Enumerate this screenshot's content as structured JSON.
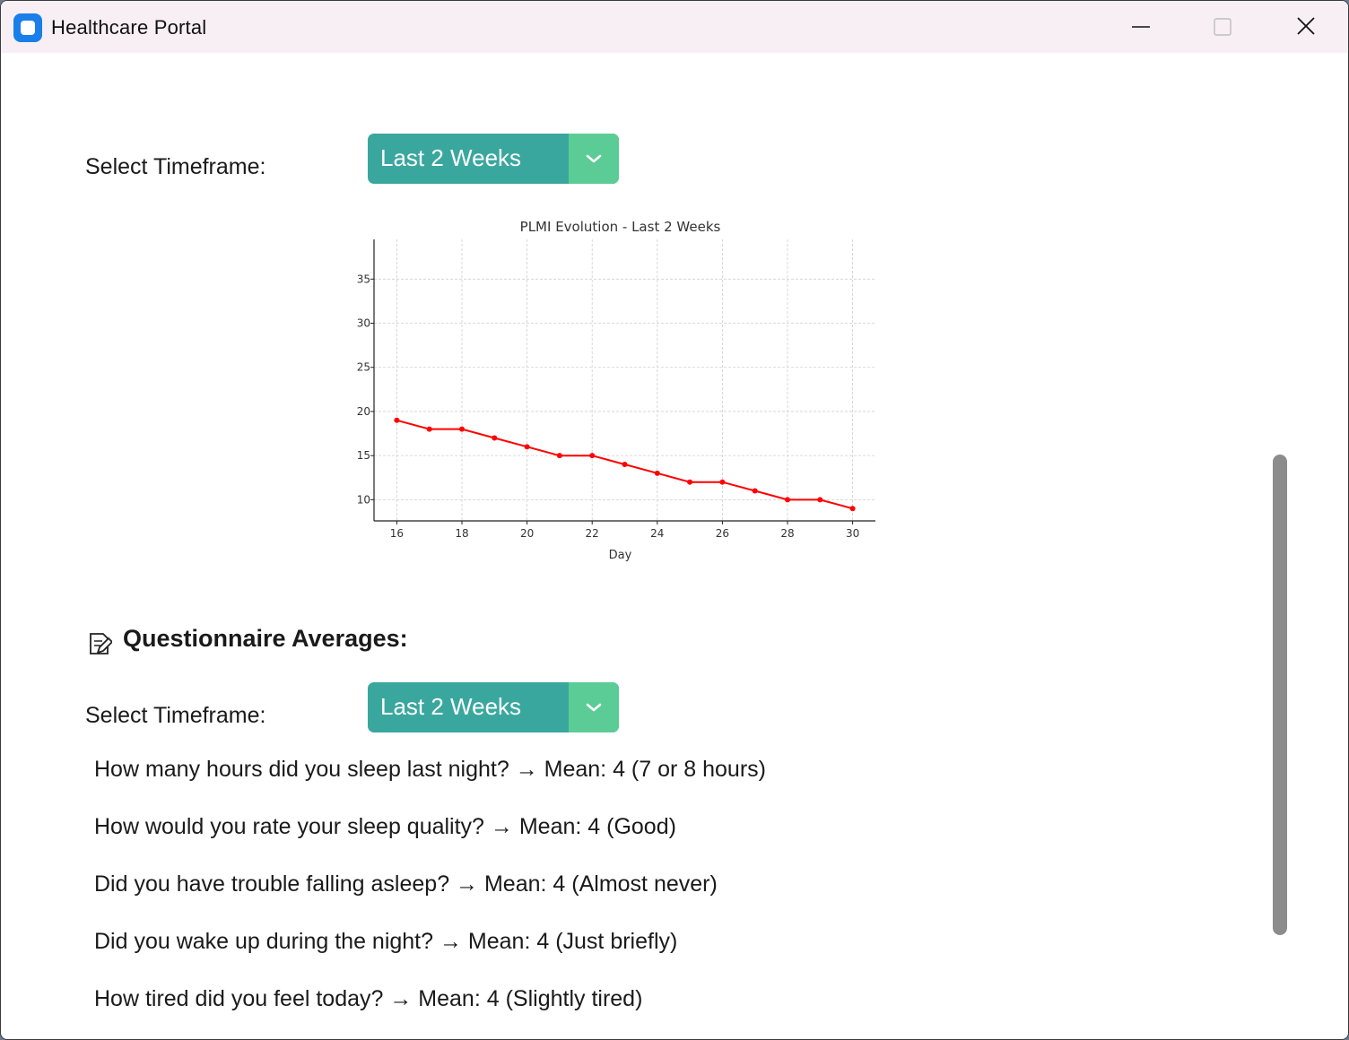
{
  "window": {
    "title": "Healthcare Portal",
    "controls": {
      "minimize": "minimize-icon",
      "maximize": "maximize-icon",
      "close": "close-icon"
    }
  },
  "plmi_section": {
    "timeframe_label": "Select Timeframe:",
    "timeframe_value": "Last 2 Weeks"
  },
  "chart_data": {
    "type": "line",
    "title": "PLMI Evolution - Last 2 Weeks",
    "xlabel": "Day",
    "ylabel": "",
    "x": [
      16,
      17,
      18,
      19,
      20,
      21,
      22,
      23,
      24,
      25,
      26,
      27,
      28,
      29,
      30
    ],
    "series": [
      {
        "values": [
          19,
          18,
          18,
          17,
          16,
          15,
          15,
          14,
          13,
          12,
          12,
          11,
          10,
          10,
          9
        ],
        "color": "#ff0000"
      }
    ],
    "xticks": [
      16,
      18,
      20,
      22,
      24,
      26,
      28,
      30
    ],
    "yticks": [
      10,
      15,
      20,
      25,
      30,
      35
    ],
    "xlim": [
      15.3,
      30.7
    ],
    "ylim": [
      7.6,
      39.5
    ],
    "grid": true
  },
  "questionnaire": {
    "icon": "memo-icon",
    "title": "Questionnaire Averages:",
    "timeframe_label": "Select Timeframe:",
    "timeframe_value": "Last 2 Weeks",
    "items": [
      "How many hours did you sleep last night? → Mean: 4 (7 or 8 hours)",
      "How would you rate your sleep quality? → Mean: 4 (Good)",
      "Did you have trouble falling asleep? → Mean: 4 (Almost never)",
      "Did you wake up during the night? → Mean: 4 (Just briefly)",
      "How tired did you feel today? → Mean: 4 (Slightly tired)"
    ]
  },
  "colors": {
    "dropdown_bg": "#3aa79f",
    "dropdown_arrow_bg": "#5ccc96",
    "series": "#ff0000",
    "scrollbar": "#8c8c8c"
  }
}
